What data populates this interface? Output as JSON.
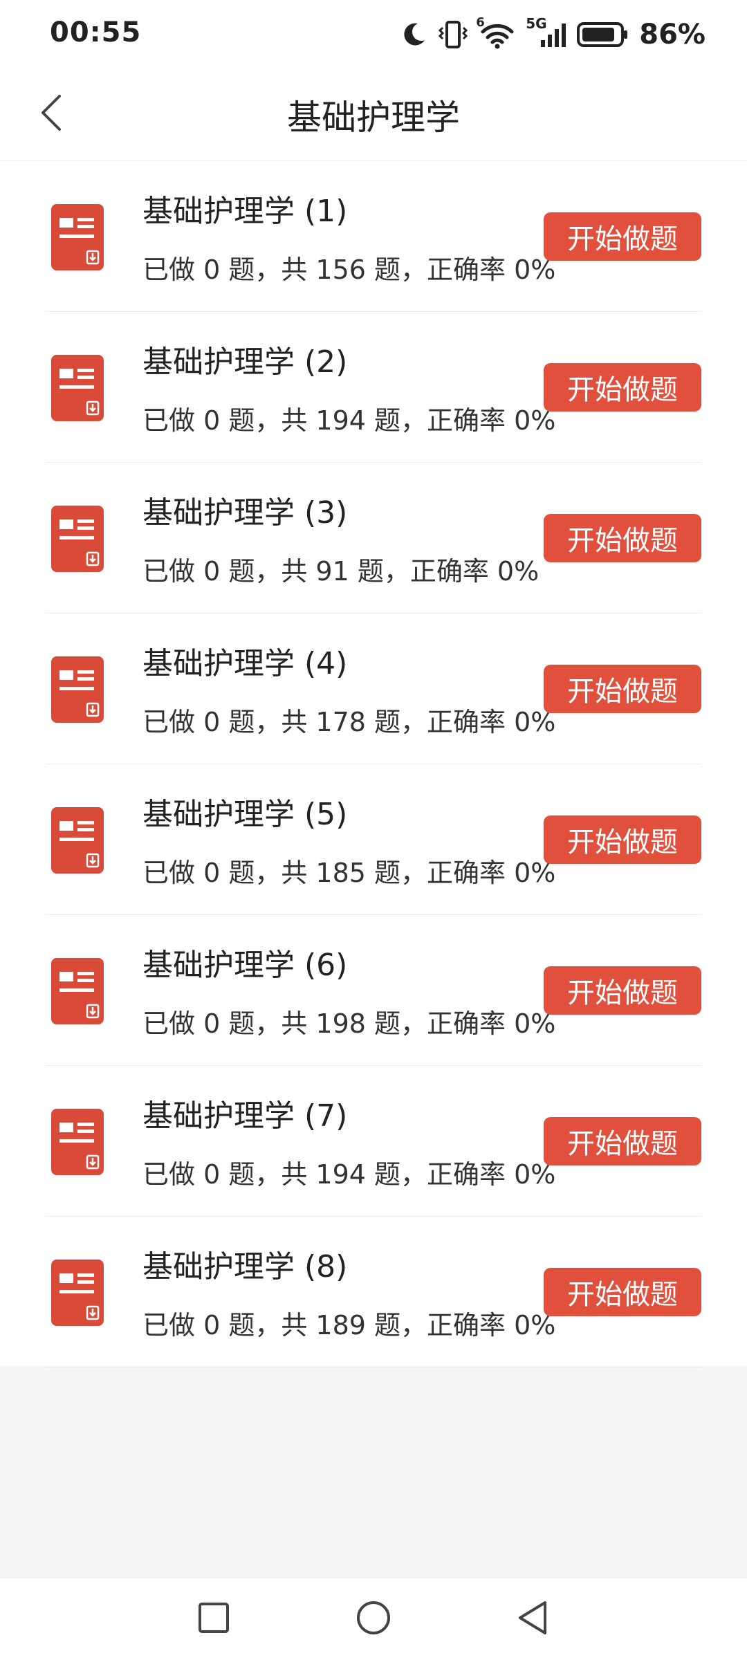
{
  "status_bar": {
    "time": "00:55",
    "battery_percent": "86%",
    "network_label": "5G",
    "wifi_label": "6",
    "battery_level": 0.86,
    "icons": [
      "moon-icon",
      "vibrate-icon",
      "wifi-icon",
      "signal-icon",
      "battery-icon"
    ]
  },
  "header": {
    "title": "基础护理学",
    "back_icon": "chevron-left-icon"
  },
  "list": {
    "items": [
      {
        "title": "基础护理学 (1)",
        "meta": "已做 0 题，共 156 题，正确率 0%",
        "button_label": "开始做题"
      },
      {
        "title": "基础护理学 (2)",
        "meta": "已做 0 题，共 194 题，正确率 0%",
        "button_label": "开始做题"
      },
      {
        "title": "基础护理学 (3)",
        "meta": "已做 0 题，共 91 题，正确率 0%",
        "button_label": "开始做题"
      },
      {
        "title": "基础护理学 (4)",
        "meta": "已做 0 题，共 178 题，正确率 0%",
        "button_label": "开始做题"
      },
      {
        "title": "基础护理学 (5)",
        "meta": "已做 0 题，共 185 题，正确率 0%",
        "button_label": "开始做题"
      },
      {
        "title": "基础护理学 (6)",
        "meta": "已做 0 题，共 198 题，正确率 0%",
        "button_label": "开始做题"
      },
      {
        "title": "基础护理学 (7)",
        "meta": "已做 0 题，共 194 题，正确率 0%",
        "button_label": "开始做题"
      },
      {
        "title": "基础护理学 (8)",
        "meta": "已做 0 题，共 189 题，正确率 0%",
        "button_label": "开始做题"
      }
    ]
  },
  "nav_bar": {
    "icons": [
      "recents-square-icon",
      "home-circle-icon",
      "back-triangle-icon"
    ]
  },
  "colors": {
    "accent": "#e0503d",
    "icon_red": "#d94a38",
    "background": "#f5f5f5",
    "surface": "#ffffff",
    "text_primary": "#222222"
  }
}
